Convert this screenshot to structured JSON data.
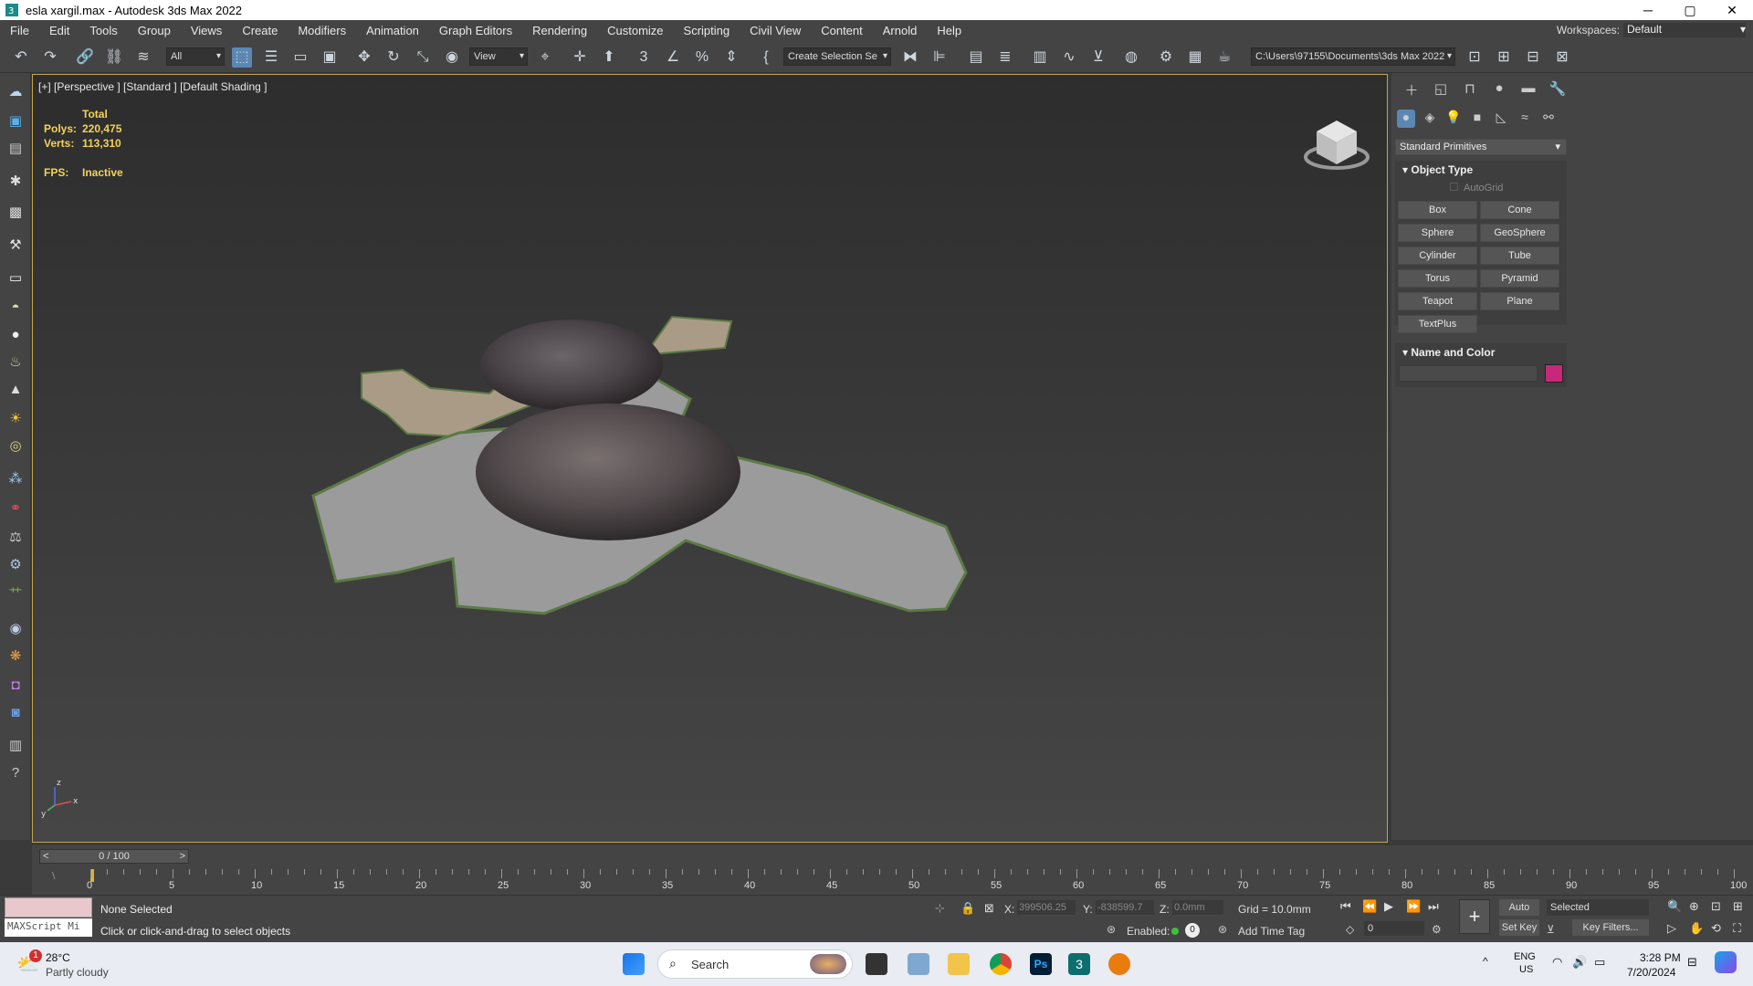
{
  "window": {
    "title": "esla xargil.max - Autodesk 3ds Max 2022",
    "minimize": "─",
    "maximize": "▢",
    "close": "✕"
  },
  "menu": {
    "items": [
      "File",
      "Edit",
      "Tools",
      "Group",
      "Views",
      "Create",
      "Modifiers",
      "Animation",
      "Graph Editors",
      "Rendering",
      "Customize",
      "Scripting",
      "Civil View",
      "Content",
      "Arnold",
      "Help"
    ],
    "workspaces_label": "Workspaces:",
    "workspaces_value": "Default"
  },
  "toolbar": {
    "selection_filter": "All",
    "ref_coord": "View",
    "named_selection": "Create Selection Se",
    "project_path": "C:\\Users\\97155\\Documents\\3ds Max 2022"
  },
  "viewport": {
    "label": "[+] [Perspective ] [Standard ] [Default Shading ]",
    "stats_total_label": "Total",
    "polys_label": "Polys:",
    "polys_value": "220,475",
    "verts_label": "Verts:",
    "verts_value": "113,310",
    "fps_label": "FPS:",
    "fps_value": "Inactive",
    "axis_x": "x",
    "axis_y": "y",
    "axis_z": "z"
  },
  "command_panel": {
    "category": "Standard Primitives",
    "object_type_title": "Object Type",
    "autogrid": "AutoGrid",
    "buttons": [
      "Box",
      "Cone",
      "Sphere",
      "GeoSphere",
      "Cylinder",
      "Tube",
      "Torus",
      "Pyramid",
      "Teapot",
      "Plane",
      "TextPlus"
    ],
    "name_color_title": "Name and Color",
    "color_swatch": "#c8287a"
  },
  "timeline": {
    "frame_counter": "0 / 100",
    "ticks": [
      "0",
      "5",
      "10",
      "15",
      "20",
      "25",
      "30",
      "35",
      "40",
      "45",
      "50",
      "55",
      "60",
      "65",
      "70",
      "75",
      "80",
      "85",
      "90",
      "95",
      "100"
    ]
  },
  "status": {
    "maxscript": "MAXScript Mi",
    "selection": "None Selected",
    "prompt": "Click or click-and-drag to select objects",
    "x_label": "X:",
    "x_value": "399506.25",
    "y_label": "Y:",
    "y_value": "-838599.7",
    "z_label": "Z:",
    "z_value": "0.0mm",
    "grid": "Grid = 10.0mm",
    "enabled": "Enabled:",
    "add_time_tag": "Add Time Tag",
    "auto_key": "Auto Key",
    "set_key": "Set Key",
    "key_mode": "Selected",
    "key_filters": "Key Filters...",
    "frame_value": "0"
  },
  "taskbar": {
    "weather_temp": "28°C",
    "weather_desc": "Partly cloudy",
    "weather_badge": "1",
    "search": "Search",
    "lang1": "ENG",
    "lang2": "US",
    "time": "3:28 PM",
    "date": "7/20/2024"
  }
}
